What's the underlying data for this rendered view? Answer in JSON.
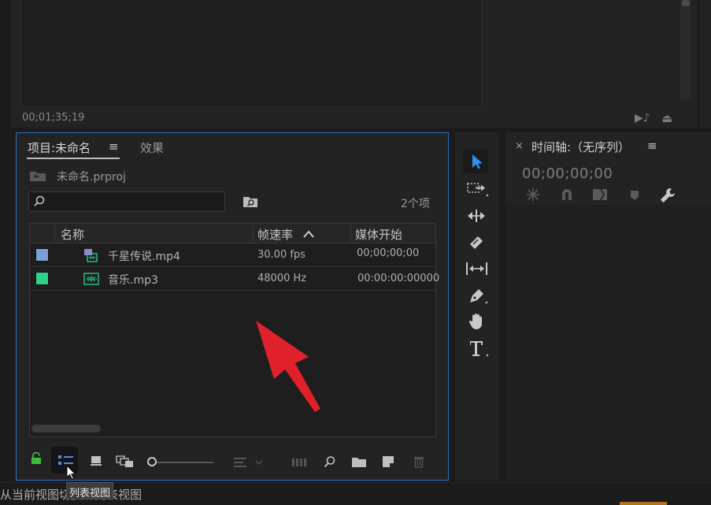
{
  "monitor": {
    "timecode": "00;01;35;19"
  },
  "project_panel": {
    "tabs": [
      {
        "label": "项目:未命名",
        "active": true
      },
      {
        "label": "效果",
        "active": false
      }
    ],
    "project_file": "未命名.prproj",
    "search": {
      "value": "",
      "placeholder": ""
    },
    "item_count": "2个项",
    "columns": [
      "名称",
      "帧速率",
      "媒体开始"
    ],
    "rows": [
      {
        "name": "千星传说.mp4",
        "frame_rate": "30.00 fps",
        "media_start": "00;00;00;00",
        "color": "#7d9fd6",
        "type": "video"
      },
      {
        "name": "音乐.mp3",
        "frame_rate": "48000 Hz",
        "media_start": "00:00:00:00000",
        "color": "#2fd08a",
        "type": "audio"
      }
    ],
    "toolbar": {
      "tooltip": "列表视图"
    }
  },
  "timeline": {
    "title": "时间轴:（无序列）",
    "timecode": "00;00;00;00"
  },
  "status_bar": {
    "text": "从当前视图切换到列表视图"
  },
  "colors": {
    "accent_blue": "#2d6fc7",
    "lock_green": "#3dbb3d",
    "arrow_red": "#e0202a"
  },
  "icons": [
    "menu-icon",
    "folder-icon",
    "search-icon",
    "bin-search-icon",
    "sort-ascending-icon",
    "video-clip-icon",
    "audio-clip-icon",
    "lock-icon",
    "list-view-icon",
    "icon-view-icon",
    "freeform-view-icon",
    "sort-icon",
    "automate-icon",
    "find-icon",
    "new-bin-icon",
    "new-item-icon",
    "trash-icon",
    "selection-tool-icon",
    "track-select-tool-icon",
    "ripple-edit-tool-icon",
    "razor-tool-icon",
    "slip-tool-icon",
    "pen-tool-icon",
    "hand-tool-icon",
    "type-tool-icon",
    "close-icon",
    "snap-icon",
    "magnet-icon",
    "linked-selection-icon",
    "add-marker-icon",
    "wrench-icon",
    "pointer-cursor-icon",
    "annotation-arrow-icon"
  ]
}
